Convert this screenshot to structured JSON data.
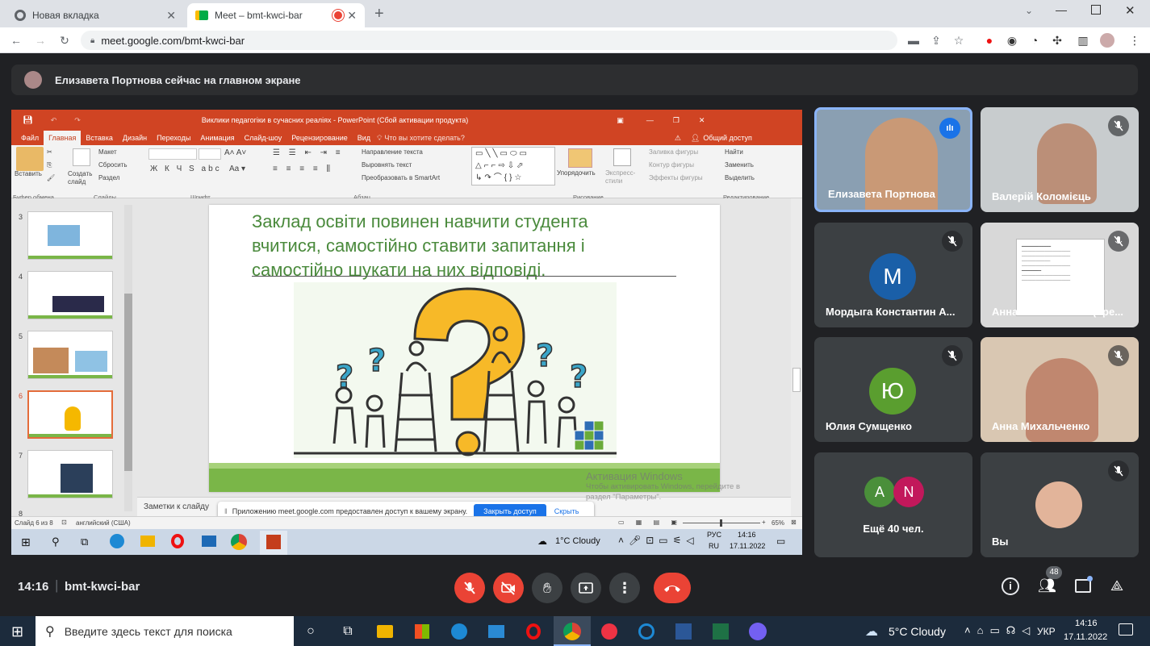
{
  "browser": {
    "tabs": [
      {
        "title": "Новая вкладка",
        "active": false
      },
      {
        "title": "Meet – bmt-kwci-bar",
        "active": true
      }
    ],
    "url": "meet.google.com/bmt-kwci-bar"
  },
  "meet": {
    "banner": "Елизавета Портнова сейчас на главном экране",
    "participants": [
      {
        "name": "Елизавета Портнова",
        "speaking": true
      },
      {
        "name": "Валерій Коломієць",
        "muted": true
      },
      {
        "name": "Мордыга Константин А...",
        "initial": "М",
        "color": "#1a5fa8",
        "muted": true
      },
      {
        "name": "Анна Михальченко (пре...",
        "muted": true
      },
      {
        "name": "Юлия Сумщенко",
        "initial": "Ю",
        "color": "#5a9e2f",
        "muted": true
      },
      {
        "name": "Анна Михальченко",
        "muted": true
      },
      {
        "name": "Ещё 40 чел.",
        "initials": [
          "A",
          "N"
        ],
        "colors": [
          "#4a8f3a",
          "#c2185b"
        ]
      },
      {
        "name": "Вы",
        "muted": true
      }
    ],
    "footer": {
      "time": "14:16",
      "meeting_code": "bmt-kwci-bar",
      "participant_count": "48"
    }
  },
  "powerpoint": {
    "title": "Виклики педагогіки в сучасних реаліях - PowerPoint (Сбой активации продукта)",
    "menu": [
      "Файл",
      "Главная",
      "Вставка",
      "Дизайн",
      "Переходы",
      "Анимация",
      "Слайд-шоу",
      "Рецензирование",
      "Вид"
    ],
    "tellme": "Что вы хотите сделать?",
    "share": "Общий доступ",
    "ribbon": {
      "paste": "Вставить",
      "create_slide": "Создать слайд",
      "layout": "Макет",
      "reset": "Сбросить",
      "section": "Раздел",
      "text_direction": "Направление текста",
      "align_text": "Выровнять текст",
      "smartart": "Преобразовать в SmartArt",
      "arrange": "Упорядочить",
      "quick_styles": "Экспресс-стили",
      "shape_fill": "Заливка фигуры",
      "shape_outline": "Контур фигуры",
      "shape_effects": "Эффекты фигуры",
      "find": "Найти",
      "replace": "Заменить",
      "select": "Выделить",
      "groups": [
        "Буфер обмена",
        "Слайды",
        "Шрифт",
        "Абзац",
        "Рисование",
        "Редактирование"
      ]
    },
    "thumbnails": [
      "3",
      "4",
      "5",
      "6",
      "7",
      "8"
    ],
    "slide": {
      "line1": "Заклад освіти повинен навчити студента",
      "line2": "вчитися, самостійно ставити запитання і",
      "line3": "самостійно шукати на них відповіді."
    },
    "notes": "Заметки к слайду",
    "status": {
      "slide": "Слайд 6 из 8",
      "lang": "английский (США)",
      "zoom": "65%"
    },
    "share_bar": {
      "text": "Приложению meet.google.com предоставлен доступ к вашему экрану.",
      "stop": "Закрыть доступ",
      "hide": "Скрыть"
    },
    "watermark": {
      "title": "Активация Windows",
      "line1": "Чтобы активировать Windows, перейдите в",
      "line2": "раздел \"Параметры\"."
    },
    "inner_taskbar": {
      "weather": "1°C  Cloudy",
      "lang1": "РУС",
      "lang2": "RU",
      "time": "14:16",
      "date": "17.11.2022"
    }
  },
  "taskbar": {
    "search_placeholder": "Введите здесь текст для поиска",
    "weather": "5°C  Cloudy",
    "lang": "УКР",
    "time": "14:16",
    "date": "17.11.2022"
  }
}
